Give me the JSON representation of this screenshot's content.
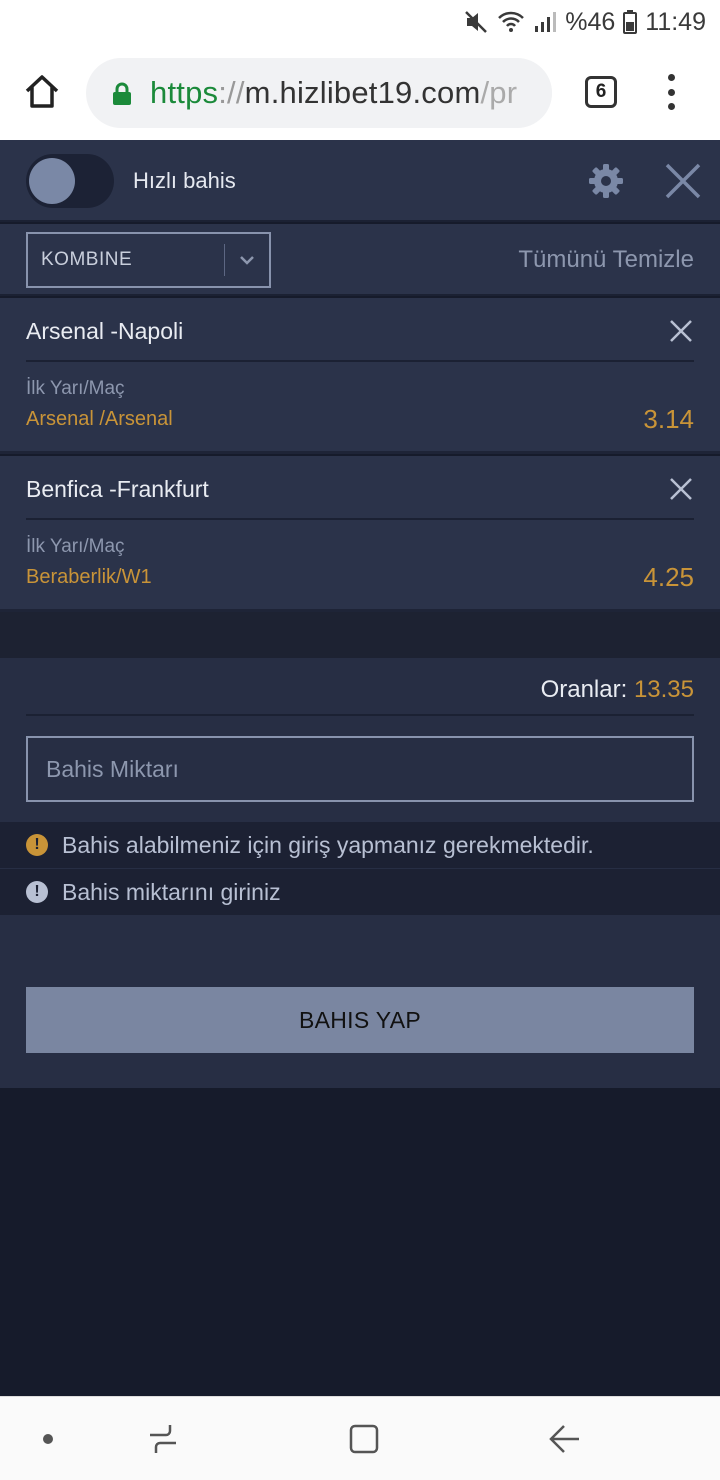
{
  "status_bar": {
    "battery": "%46",
    "time": "11:49",
    "icons": [
      "mute-icon",
      "wifi-icon",
      "signal-icon",
      "battery-icon"
    ]
  },
  "browser": {
    "url_scheme": "https",
    "url_separator": "://",
    "url_host": "m.hizlibet19.com",
    "url_path": "/pr",
    "tab_count": "6"
  },
  "betslip": {
    "quick_bet_label": "Hızlı bahis",
    "quick_bet_enabled": false,
    "bet_type": "KOMBINE",
    "clear_all": "Tümünü Temizle",
    "selections": [
      {
        "match": "Arsenal -Napoli",
        "market": "İlk Yarı/Maç",
        "pick": "Arsenal /Arsenal",
        "odd": "3.14"
      },
      {
        "match": "Benfica -Frankfurt",
        "market": "İlk Yarı/Maç",
        "pick": "Beraberlik/W1",
        "odd": "4.25"
      }
    ],
    "odds_label": "Oranlar:",
    "odds_value": "13.35",
    "amount_placeholder": "Bahis Miktarı",
    "warnings": [
      "Bahis alabilmeniz için giriş yapmanız gerekmektedir.",
      "Bahis miktarını giriniz"
    ],
    "place_bet": "BAHIS YAP"
  },
  "colors": {
    "panel": "#2b334a",
    "accent_odds": "#c99438",
    "button": "#7a86a1",
    "background": "#161b2b"
  }
}
